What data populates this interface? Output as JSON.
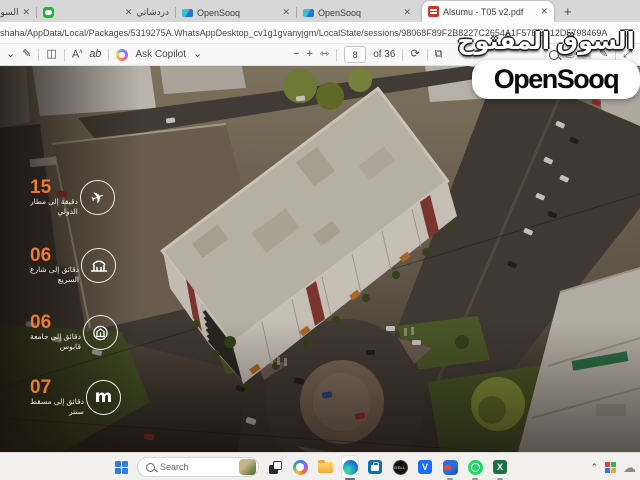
{
  "browser": {
    "tabs": [
      {
        "title": "السوق المفتوح"
      },
      {
        "title": "دردشاتي"
      },
      {
        "title": "OpenSooq"
      },
      {
        "title": "OpenSooq"
      },
      {
        "title": "Alsumu - T05 v2.pdf"
      }
    ],
    "address": "shaha/AppData/Local/Packages/5319275A.WhatsAppDesktop_cv1g1gvanyjgm/LocalState/sessions/98068F89F2B8227C2654A1F57EEC12D5798469A"
  },
  "pdf_toolbar": {
    "ask_copilot": "Ask Copilot",
    "page_current": "8",
    "page_total": "of 36",
    "read_aloud": "A",
    "translate": "ab"
  },
  "overlay_logo": {
    "arabic": "السوق المفتوح",
    "latin": "OpenSooq"
  },
  "sidebar": {
    "accent_color": "#ed7a2f",
    "items": [
      {
        "num": "15",
        "line1": "دقيقة إلى مطار",
        "line2": "الدولي",
        "icon": "airplane"
      },
      {
        "num": "06",
        "line1": "دقائق إلى شارع",
        "line2": "السريع",
        "icon": "highway"
      },
      {
        "num": "06",
        "line1": "دقائق إلى جامعة",
        "line2": "قابوس",
        "icon": "university"
      },
      {
        "num": "07",
        "line1": "دقائق إلى مسقط",
        "line2": "سنتر",
        "icon": "mall"
      }
    ]
  },
  "taskbar": {
    "search_placeholder": "Search",
    "dell_label": "DELL",
    "dropbox_glyph": "V",
    "excel_glyph": "X"
  },
  "scene_colors": {
    "asphalt": "#46413b",
    "dirt": "#7b6c5b",
    "lawn": "#55652c",
    "roof": "#d8d1c5",
    "building_accent": "#8e3b34"
  }
}
